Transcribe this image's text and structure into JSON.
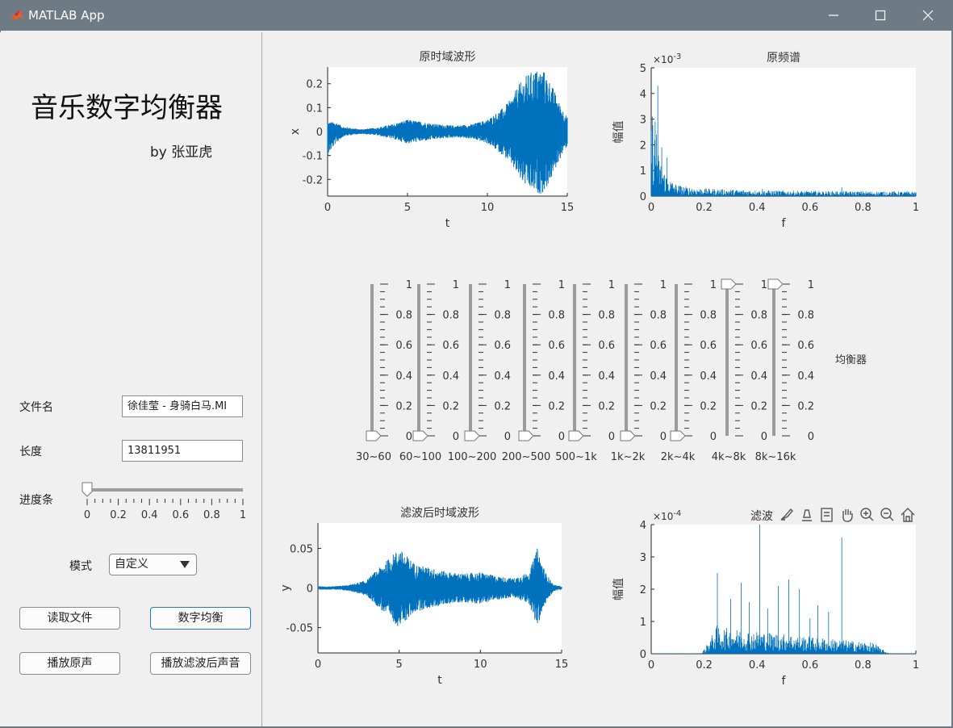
{
  "window": {
    "title": "MATLAB App",
    "controls": [
      "minimize",
      "maximize",
      "close"
    ]
  },
  "left": {
    "app_title": "音乐数字均衡器",
    "author": "by 张亚虎",
    "filename_label": "文件名",
    "filename_value": "徐佳莹 - 身骑白马.MI",
    "length_label": "长度",
    "length_value": "13811951",
    "progress_label": "进度条",
    "progress": {
      "value": 0,
      "ticks": [
        "0",
        "0.2",
        "0.4",
        "0.6",
        "0.8",
        "1"
      ]
    },
    "mode_label": "模式",
    "mode_value": "自定义",
    "buttons": {
      "read": "读取文件",
      "equalize": "数字均衡",
      "play_original": "播放原声",
      "play_filtered": "播放滤波后声音"
    }
  },
  "equalizer": {
    "label": "均衡器",
    "tick_labels": [
      "1",
      "0.8",
      "0.6",
      "0.4",
      "0.2",
      "0"
    ],
    "bands": [
      {
        "label": "30~60",
        "value": 0
      },
      {
        "label": "60~100",
        "value": 0
      },
      {
        "label": "100~200",
        "value": 0
      },
      {
        "label": "200~500",
        "value": 0
      },
      {
        "label": "500~1k",
        "value": 0
      },
      {
        "label": "1k~2k",
        "value": 0
      },
      {
        "label": "2k~4k",
        "value": 0
      },
      {
        "label": "4k~8k",
        "value": 1
      },
      {
        "label": "8k~16k",
        "value": 1
      }
    ]
  },
  "axes_toolbar": {
    "overlay_text": "滤波",
    "icons": [
      "brush-icon",
      "data-tips-icon",
      "data-cursor-icon",
      "pan-hand-icon",
      "zoom-in-icon",
      "zoom-out-icon",
      "home-icon"
    ]
  },
  "line_color": "#0072bd",
  "chart_data": [
    {
      "type": "line",
      "title": "原时域波形",
      "xlabel": "t",
      "ylabel": "x",
      "xlim": [
        0,
        15
      ],
      "ylim": [
        -0.27,
        0.27
      ],
      "xticks": [
        "0",
        "5",
        "10",
        "15"
      ],
      "yticks": [
        "0.2",
        "0.1",
        "0",
        "-0.1",
        "-0.2"
      ],
      "envelope": {
        "t": [
          0,
          0.5,
          1,
          2,
          3,
          4,
          5,
          6,
          7,
          8,
          9,
          10,
          11,
          11.5,
          12,
          12.5,
          13,
          13.5,
          14,
          14.5,
          15
        ],
        "upper": [
          0.04,
          0.04,
          0.02,
          0.01,
          0.015,
          0.03,
          0.05,
          0.04,
          0.03,
          0.025,
          0.03,
          0.05,
          0.1,
          0.14,
          0.2,
          0.24,
          0.26,
          0.26,
          0.2,
          0.12,
          0.06
        ],
        "lower": [
          -0.1,
          -0.05,
          -0.02,
          -0.01,
          -0.015,
          -0.03,
          -0.05,
          -0.04,
          -0.03,
          -0.025,
          -0.03,
          -0.05,
          -0.1,
          -0.14,
          -0.2,
          -0.24,
          -0.26,
          -0.26,
          -0.2,
          -0.12,
          -0.06
        ]
      }
    },
    {
      "type": "line",
      "title": "原频谱",
      "xlabel": "f",
      "ylabel": "幅值",
      "exponent": "×10^-3",
      "xlim": [
        0,
        1
      ],
      "ylim": [
        0,
        5
      ],
      "xticks": [
        "0",
        "0.2",
        "0.4",
        "0.6",
        "0.8",
        "1"
      ],
      "yticks": [
        "5",
        "4",
        "3",
        "2",
        "1",
        "0"
      ],
      "peaks": [
        {
          "x": 0.025,
          "y": 4.3
        },
        {
          "x": 0.015,
          "y": 2.9
        },
        {
          "x": 0.02,
          "y": 2.4
        },
        {
          "x": 0.04,
          "y": 1.9
        },
        {
          "x": 0.06,
          "y": 1.5
        },
        {
          "x": 0.72,
          "y": 0.35
        },
        {
          "x": 0.42,
          "y": 0.28
        }
      ]
    },
    {
      "type": "line",
      "title": "滤波后时域波形",
      "xlabel": "t",
      "ylabel": "y",
      "xlim": [
        0,
        15
      ],
      "ylim": [
        -0.082,
        0.082
      ],
      "xticks": [
        "0",
        "5",
        "10",
        "15"
      ],
      "yticks": [
        "0.05",
        "0",
        "-0.05"
      ],
      "envelope": {
        "t": [
          0,
          1,
          2,
          3,
          3.5,
          4,
          4.5,
          5,
          5.5,
          6,
          7,
          8,
          9,
          10,
          11,
          12,
          13,
          13.5,
          14,
          14.5,
          15
        ],
        "upper": [
          0.002,
          0.002,
          0.004,
          0.01,
          0.02,
          0.03,
          0.04,
          0.05,
          0.04,
          0.03,
          0.025,
          0.02,
          0.018,
          0.02,
          0.015,
          0.012,
          0.02,
          0.05,
          0.02,
          0.004,
          0.002
        ],
        "lower": [
          -0.002,
          -0.002,
          -0.004,
          -0.01,
          -0.02,
          -0.03,
          -0.04,
          -0.05,
          -0.04,
          -0.03,
          -0.025,
          -0.02,
          -0.018,
          -0.02,
          -0.015,
          -0.012,
          -0.02,
          -0.05,
          -0.02,
          -0.004,
          -0.002
        ]
      }
    },
    {
      "type": "line",
      "title": "",
      "xlabel": "f",
      "ylabel": "幅值",
      "exponent": "×10^-4",
      "xlim": [
        0,
        1
      ],
      "ylim": [
        0,
        4
      ],
      "xticks": [
        "0",
        "0.2",
        "0.4",
        "0.6",
        "0.8",
        "1"
      ],
      "yticks": [
        "4",
        "3",
        "2",
        "1",
        "0"
      ],
      "peaks": [
        {
          "x": 0.41,
          "y": 4.0
        },
        {
          "x": 0.72,
          "y": 3.6
        },
        {
          "x": 0.25,
          "y": 2.5
        },
        {
          "x": 0.52,
          "y": 2.3
        },
        {
          "x": 0.34,
          "y": 2.2
        },
        {
          "x": 0.48,
          "y": 2.1
        },
        {
          "x": 0.56,
          "y": 2.0
        },
        {
          "x": 0.3,
          "y": 1.7
        },
        {
          "x": 0.63,
          "y": 1.5
        },
        {
          "x": 0.44,
          "y": 1.4
        },
        {
          "x": 0.37,
          "y": 1.6
        },
        {
          "x": 0.67,
          "y": 1.3
        },
        {
          "x": 0.6,
          "y": 1.1
        }
      ]
    }
  ]
}
